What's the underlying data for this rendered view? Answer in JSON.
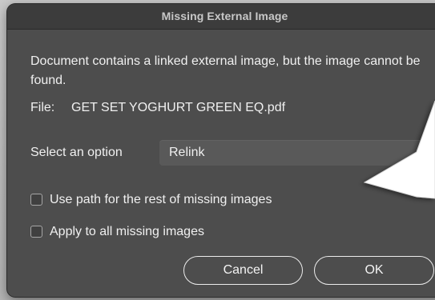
{
  "dialog": {
    "title": "Missing External Image",
    "message": "Document contains a linked external image, but the image cannot be found.",
    "file_label": "File:",
    "file_name": "GET SET YOGHURT GREEN EQ.pdf",
    "select_label": "Select an option",
    "select_value": "Relink",
    "checkbox_use_path": {
      "label": "Use path for the rest of missing images",
      "checked": false
    },
    "checkbox_apply_all": {
      "label": "Apply to all missing images",
      "checked": false
    },
    "cancel_label": "Cancel",
    "ok_label": "OK"
  },
  "colors": {
    "dialog_background": "#4d4d4d",
    "titlebar_background": "#3c3c3c",
    "text": "#f0f0f0",
    "callout_fill": "#ffffff"
  }
}
